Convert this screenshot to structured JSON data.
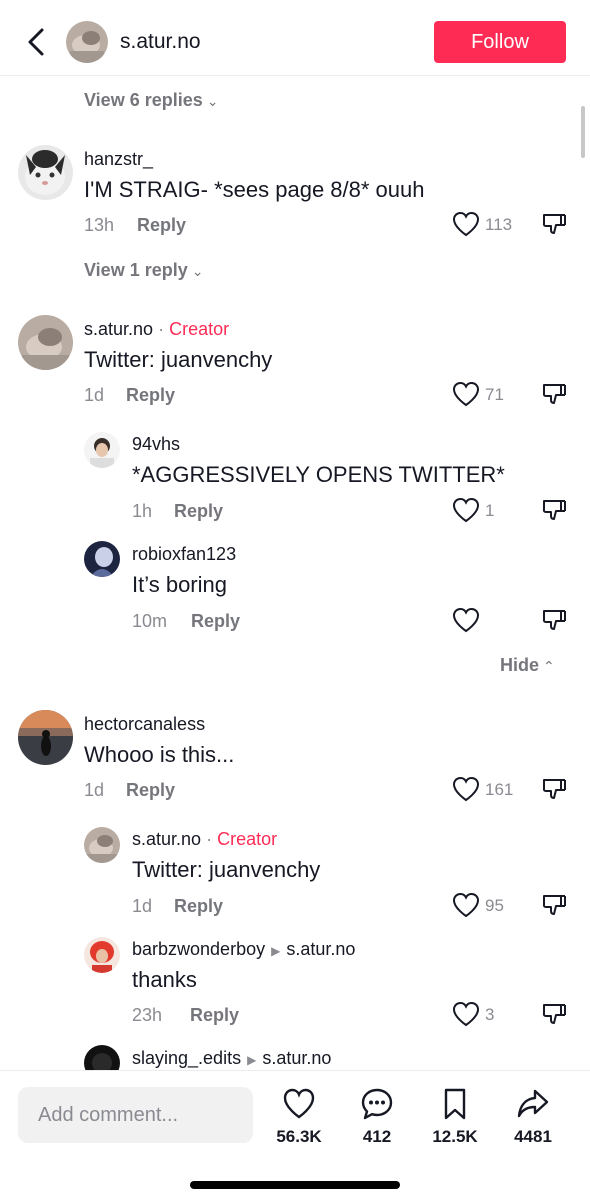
{
  "header": {
    "username": "s.atur.no",
    "follow_label": "Follow"
  },
  "threads": [
    {
      "view_replies": "View 6 replies",
      "comment": {
        "username": "hanzstr_",
        "text": "I'M STRAIG- *sees page 8/8* ouuh",
        "time": "13h",
        "reply_label": "Reply",
        "likes": "113"
      },
      "view_replies_after": "View 1 reply"
    },
    {
      "comment": {
        "username": "s.atur.no",
        "dot": "·",
        "badge": "Creator",
        "text": "Twitter: juanvenchy",
        "time": "1d",
        "reply_label": "Reply",
        "likes": "71"
      },
      "replies": [
        {
          "username": "94vhs",
          "text": "*AGGRESSIVELY OPENS TWITTER*",
          "time": "1h",
          "reply_label": "Reply",
          "likes": "1"
        },
        {
          "username": "robioxfan123",
          "text": "It’s boring",
          "time": "10m",
          "reply_label": "Reply",
          "likes": ""
        }
      ],
      "hide_label": "Hide"
    },
    {
      "comment": {
        "username": "hectorcanaless",
        "text": "Whooo is this...",
        "time": "1d",
        "reply_label": "Reply",
        "likes": "161"
      },
      "replies": [
        {
          "username": "s.atur.no",
          "dot": "·",
          "badge": "Creator",
          "text": "Twitter: juanvenchy",
          "time": "1d",
          "reply_label": "Reply",
          "likes": "95"
        },
        {
          "username": "barbzwonderboy",
          "reply_to": "s.atur.no",
          "text": "thanks",
          "time": "23h",
          "reply_label": "Reply",
          "likes": "3"
        },
        {
          "username": "slaying_.edits",
          "reply_to": "s.atur.no"
        }
      ]
    }
  ],
  "bottom_bar": {
    "comment_placeholder": "Add comment...",
    "actions": [
      {
        "icon": "heart-icon",
        "count": "56.3K"
      },
      {
        "icon": "comment-bubble-icon",
        "count": "412"
      },
      {
        "icon": "bookmark-icon",
        "count": "12.5K"
      },
      {
        "icon": "share-icon",
        "count": "4481"
      }
    ]
  },
  "colors": {
    "accent": "#fe2c55",
    "secondary_text": "#8a8b91",
    "primary_text": "#161823"
  }
}
